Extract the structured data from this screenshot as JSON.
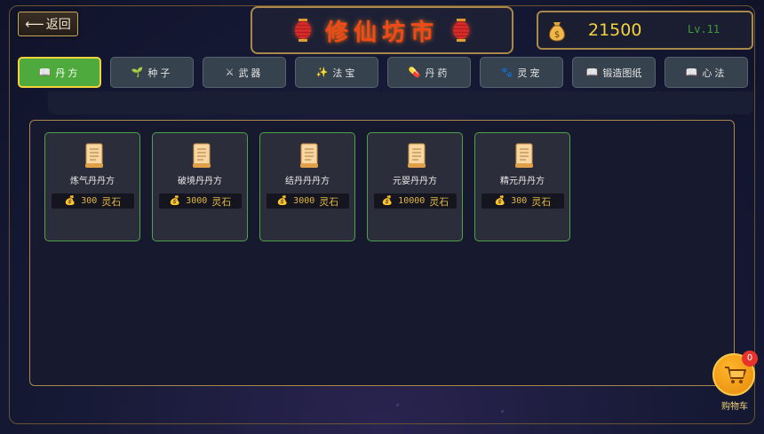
{
  "header": {
    "back_label": "返回",
    "title": "修仙坊市",
    "money": "21500",
    "level": "Lv.11"
  },
  "tabs": [
    {
      "icon": "📖",
      "label": "丹方",
      "active": true
    },
    {
      "icon": "🌱",
      "label": "种子",
      "active": false
    },
    {
      "icon": "⚔",
      "label": "武器",
      "active": false
    },
    {
      "icon": "✨",
      "label": "法宝",
      "active": false
    },
    {
      "icon": "💊",
      "label": "丹药",
      "active": false
    },
    {
      "icon": "🐾",
      "label": "灵宠",
      "active": false
    },
    {
      "icon": "📖",
      "label": "锻造图纸",
      "active": false
    },
    {
      "icon": "📖",
      "label": "心法",
      "active": false
    }
  ],
  "items": [
    {
      "name": "炼气丹丹方",
      "price": "300",
      "currency": "灵石"
    },
    {
      "name": "破境丹丹方",
      "price": "3000",
      "currency": "灵石"
    },
    {
      "name": "结丹丹丹方",
      "price": "3000",
      "currency": "灵石"
    },
    {
      "name": "元婴丹丹方",
      "price": "10000",
      "currency": "灵石"
    },
    {
      "name": "精元丹丹方",
      "price": "300",
      "currency": "灵石"
    }
  ],
  "cart": {
    "count": "0",
    "label": "购物车"
  },
  "colors": {
    "accent_gold": "#a8894a",
    "active_tab": "#4faa3e",
    "money_text": "#f4d23f",
    "title_red": "#ee4a1a"
  }
}
